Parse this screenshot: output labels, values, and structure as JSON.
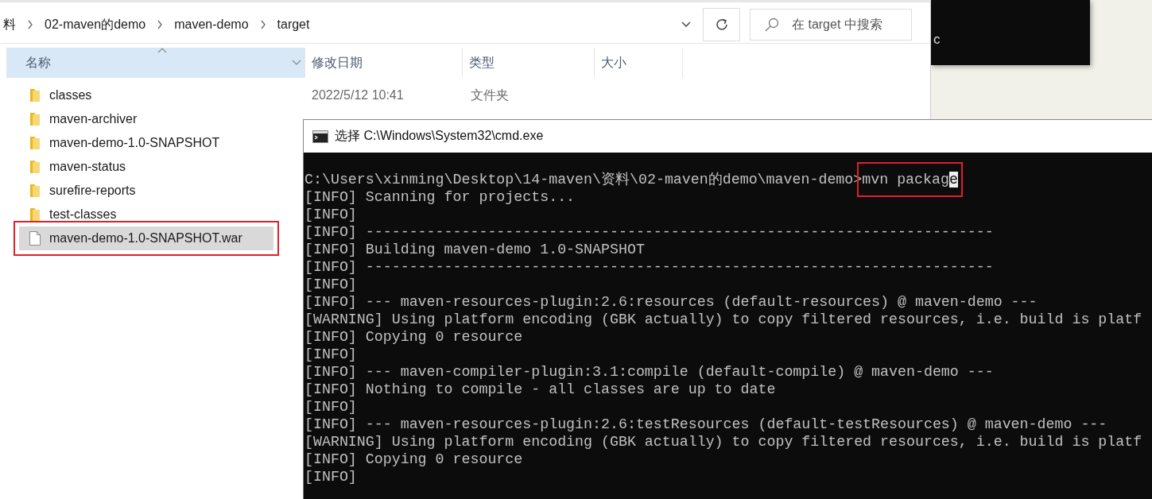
{
  "background_window": {
    "text": "c"
  },
  "explorer": {
    "breadcrumb": [
      "料",
      "02-maven的demo",
      "maven-demo",
      "target"
    ],
    "search": {
      "placeholder": "在 target 中搜索"
    },
    "columns": [
      {
        "label": "名称",
        "sorted": true
      },
      {
        "label": "修改日期",
        "sorted": false
      },
      {
        "label": "类型",
        "sorted": false
      },
      {
        "label": "大小",
        "sorted": false
      }
    ],
    "files": [
      {
        "name": "classes",
        "kind": "folder",
        "date": "2022/5/12 10:41",
        "type": "文件夹",
        "selected": false,
        "highlighted": false
      },
      {
        "name": "maven-archiver",
        "kind": "folder",
        "selected": false,
        "highlighted": false
      },
      {
        "name": "maven-demo-1.0-SNAPSHOT",
        "kind": "folder",
        "selected": false,
        "highlighted": false
      },
      {
        "name": "maven-status",
        "kind": "folder",
        "selected": false,
        "highlighted": false
      },
      {
        "name": "surefire-reports",
        "kind": "folder",
        "selected": false,
        "highlighted": false
      },
      {
        "name": "test-classes",
        "kind": "folder",
        "selected": false,
        "highlighted": false
      },
      {
        "name": "maven-demo-1.0-SNAPSHOT.war",
        "kind": "file",
        "selected": true,
        "highlighted": true
      }
    ]
  },
  "terminal": {
    "title": "选择 C:\\Windows\\System32\\cmd.exe",
    "prompt": "C:\\Users\\xinming\\Desktop\\14-maven\\资料\\02-maven的demo\\maven-demo>",
    "command": "mvn packag",
    "cursor": "e",
    "command_highlighted": true,
    "lines": [
      "[INFO] Scanning for projects...",
      "[INFO]",
      "[INFO] ------------------------------------------------------------------------",
      "[INFO] Building maven-demo 1.0-SNAPSHOT",
      "[INFO] ------------------------------------------------------------------------",
      "[INFO]",
      "[INFO] --- maven-resources-plugin:2.6:resources (default-resources) @ maven-demo ---",
      "[WARNING] Using platform encoding (GBK actually) to copy filtered resources, i.e. build is platf",
      "[INFO] Copying 0 resource",
      "[INFO]",
      "[INFO] --- maven-compiler-plugin:3.1:compile (default-compile) @ maven-demo ---",
      "[INFO] Nothing to compile - all classes are up to date",
      "[INFO]",
      "[INFO] --- maven-resources-plugin:2.6:testResources (default-testResources) @ maven-demo ---",
      "[WARNING] Using platform encoding (GBK actually) to copy filtered resources, i.e. build is platf",
      "[INFO] Copying 0 resource",
      "[INFO]"
    ]
  }
}
